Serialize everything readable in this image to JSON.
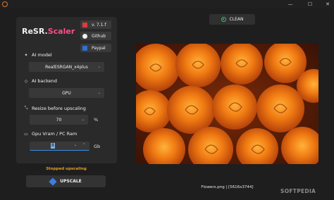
{
  "window": {
    "minimize_glyph": "—",
    "maximize_glyph": "☐",
    "close_glyph": "✕"
  },
  "app": {
    "logo_main": "ReSR.",
    "logo_accent": "Scaler"
  },
  "side_buttons": {
    "version": "v. 7.1.f",
    "github": "Github",
    "paypal": "Paypal"
  },
  "settings": {
    "ai_model": {
      "label": "AI model",
      "value": "RealESRGAN_x4plus"
    },
    "ai_backend": {
      "label": "AI backend",
      "value": "GPU"
    },
    "resize": {
      "label": "Resize before upscaling",
      "value": "70",
      "unit": "%"
    },
    "vram": {
      "label": "Gpu Vram / PC Ram",
      "value": "8",
      "unit": "Gb"
    }
  },
  "status": {
    "text": "Stopped upscaling",
    "color": "#e8a020"
  },
  "actions": {
    "upscale_label": "UPSCALE",
    "clean_label": "CLEAN"
  },
  "preview": {
    "caption": "Flowers.png | [5616x3744]"
  },
  "watermark": "SOFTPEDIA",
  "colors": {
    "accent_pink": "#ff4d8a",
    "accent_blue": "#3a8de0",
    "clean_green": "#2ec46a",
    "status_orange": "#e8a020"
  },
  "icons": {
    "ai_model": "sparkle-icon",
    "ai_backend": "chip-icon",
    "resize": "resize-icon",
    "vram": "memory-icon",
    "upscale": "cube-icon",
    "clean": "clean-circle-icon"
  }
}
